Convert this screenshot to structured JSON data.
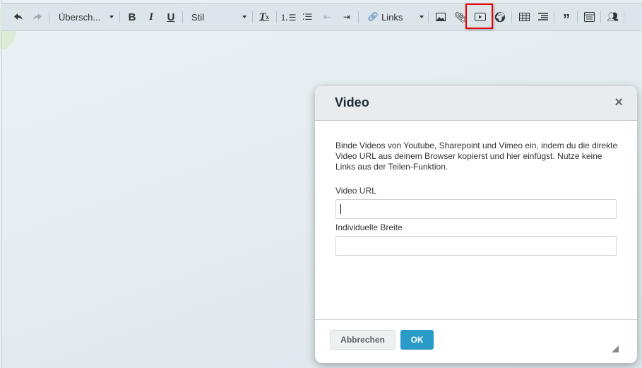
{
  "toolbar": {
    "heading_dropdown": "Übersch...",
    "style_dropdown": "Stil",
    "link_dropdown": "Links",
    "highlight_color": "#e00000",
    "items": [
      "undo-icon",
      "redo-icon",
      "bold-icon",
      "italic-icon",
      "underline-icon",
      "clear-format-icon",
      "ordered-list-icon",
      "bullet-list-icon",
      "outdent-icon",
      "indent-icon",
      "link-icon",
      "image-icon",
      "attachment-icon",
      "video-icon",
      "globe-icon",
      "table-icon",
      "toc-icon",
      "quote-icon",
      "template-icon",
      "people-icon"
    ]
  },
  "dialog": {
    "title": "Video",
    "close": "×",
    "description": "Binde Videos von Youtube, Sharepoint und Vimeo ein, indem du die direkte Video URL aus deinem Browser kopierst und hier einfügst. Nutze keine Links aus der Teilen-Funktion.",
    "video_url_label": "Video URL",
    "video_url_value": "",
    "width_label": "Individuelle Breite",
    "width_value": "",
    "cancel_label": "Abbrechen",
    "ok_label": "OK",
    "ok_color": "#2a9ac8"
  }
}
